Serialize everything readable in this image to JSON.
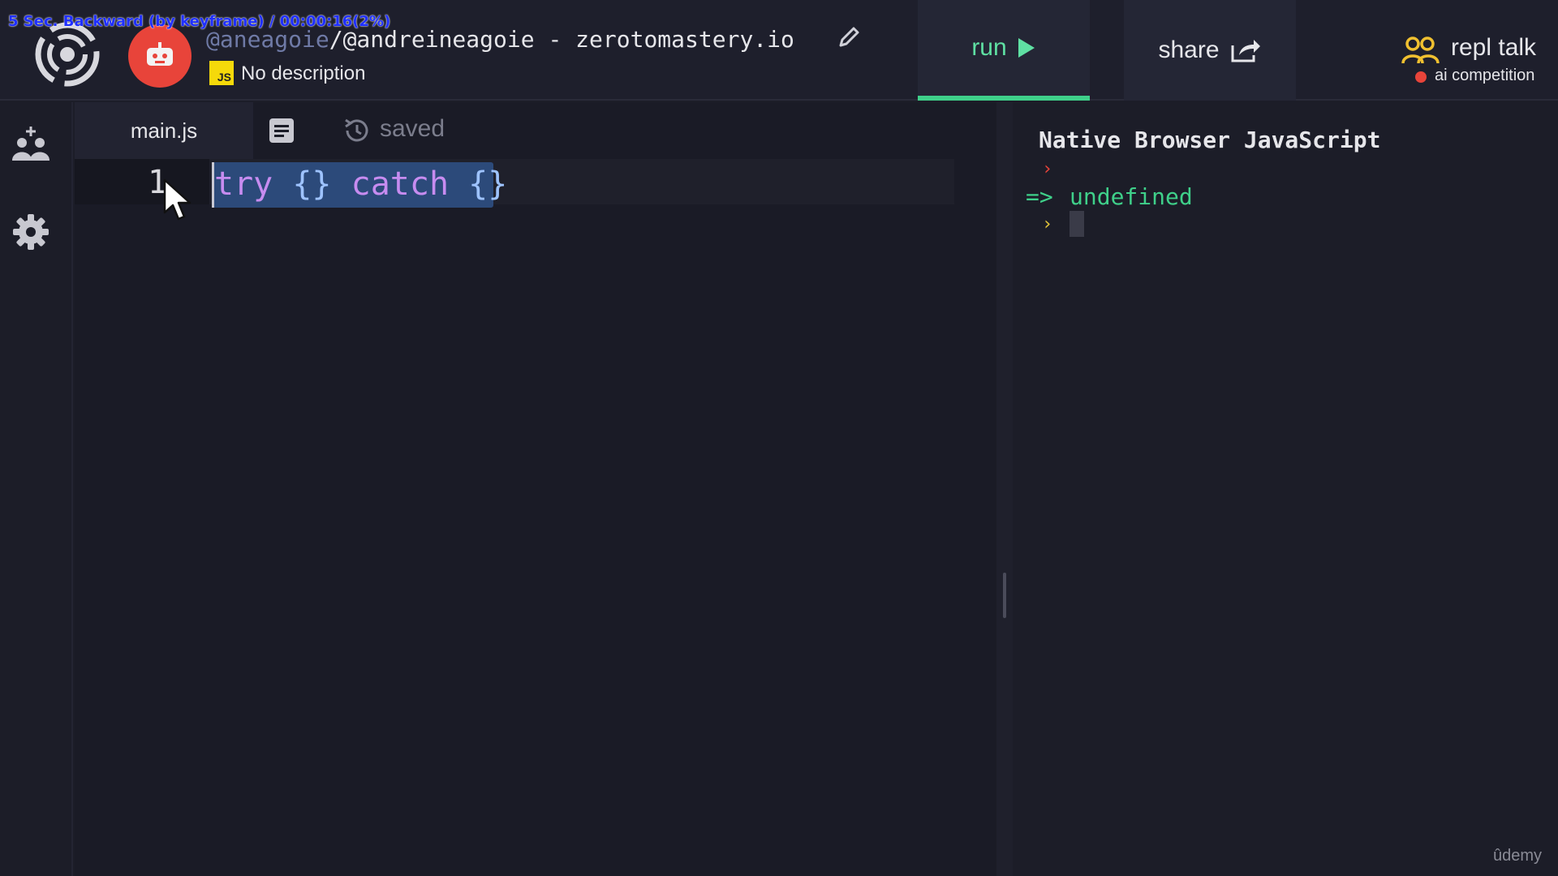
{
  "overlay": {
    "playback_text": "5 Sec. Backward (by keyframe) / 00:00:16(2%)"
  },
  "header": {
    "repl_owner": "@aneagoie",
    "repl_name": "/@andreineagoie - zerotomastery.io",
    "lang_badge": "JS",
    "description": "No description",
    "run_label": "run",
    "share_label": "share",
    "talk_title": "repl talk",
    "talk_subtitle": "ai competition"
  },
  "editor": {
    "tab_label": "main.js",
    "saved_label": "saved",
    "line_number": "1",
    "code_tokens": [
      "try",
      "{}",
      "catch",
      "{}"
    ]
  },
  "console": {
    "title": "Native Browser JavaScript",
    "prompt": "›",
    "result_arrow": "=>",
    "result": "undefined"
  },
  "watermark": "ûdemy",
  "colors": {
    "accent_green": "#3fd08a",
    "selection": "#2c4a7a",
    "keyword": "#c78cf0",
    "avatar_red": "#e8443a",
    "js_yellow": "#f5d90a"
  },
  "icons": [
    "replit-logo-icon",
    "avatar-icon",
    "pencil-icon",
    "play-icon",
    "share-icon",
    "people-icon",
    "add-user-icon",
    "gear-icon",
    "files-icon",
    "history-icon",
    "mouse-pointer-icon"
  ]
}
